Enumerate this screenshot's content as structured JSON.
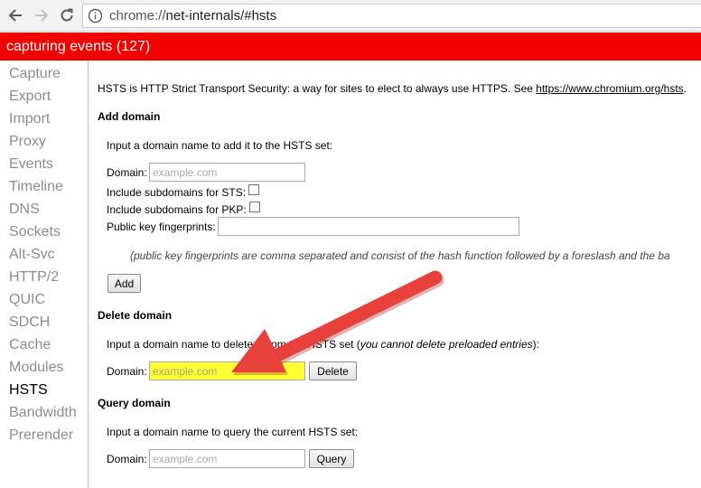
{
  "browser": {
    "url_scheme": "chrome://",
    "url_rest": "net-internals/#hsts"
  },
  "banner": {
    "text": "capturing events (127)"
  },
  "sidebar": {
    "items": [
      {
        "label": "Capture"
      },
      {
        "label": "Export"
      },
      {
        "label": "Import"
      },
      {
        "label": "Proxy"
      },
      {
        "label": "Events"
      },
      {
        "label": "Timeline"
      },
      {
        "label": "DNS"
      },
      {
        "label": "Sockets"
      },
      {
        "label": "Alt-Svc"
      },
      {
        "label": "HTTP/2"
      },
      {
        "label": "QUIC"
      },
      {
        "label": "SDCH"
      },
      {
        "label": "Cache"
      },
      {
        "label": "Modules"
      },
      {
        "label": "HSTS"
      },
      {
        "label": "Bandwidth"
      },
      {
        "label": "Prerender"
      }
    ],
    "selected": "HSTS"
  },
  "content": {
    "intro_text": "HSTS is HTTP Strict Transport Security: a way for sites to elect to always use HTTPS. See ",
    "intro_link": "https://www.chromium.org/hsts",
    "intro_end": ".",
    "add": {
      "title": "Add domain",
      "instruction": "Input a domain name to add it to the HSTS set:",
      "domain_label": "Domain:",
      "domain_placeholder": "example.com",
      "sts_label": "Include subdomains for STS:",
      "pkp_label": "Include subdomains for PKP:",
      "fingerprints_label": "Public key fingerprints:",
      "note": "(public key fingerprints are comma separated and consist of the hash function followed by a foreslash and the ba",
      "button": "Add"
    },
    "delete": {
      "title": "Delete domain",
      "instruction_start": "Input a domain name to delete it from the HSTS set (",
      "instruction_italic": "you cannot delete preloaded entries",
      "instruction_end": "):",
      "domain_label": "Domain:",
      "domain_placeholder": "example.com",
      "button": "Delete"
    },
    "query": {
      "title": "Query domain",
      "instruction": "Input a domain name to query the current HSTS set:",
      "domain_label": "Domain:",
      "domain_placeholder": "example.com",
      "button": "Query"
    }
  },
  "colors": {
    "banner": "#f20000",
    "highlight": "#ffff33",
    "arrow": "#e8403a"
  }
}
